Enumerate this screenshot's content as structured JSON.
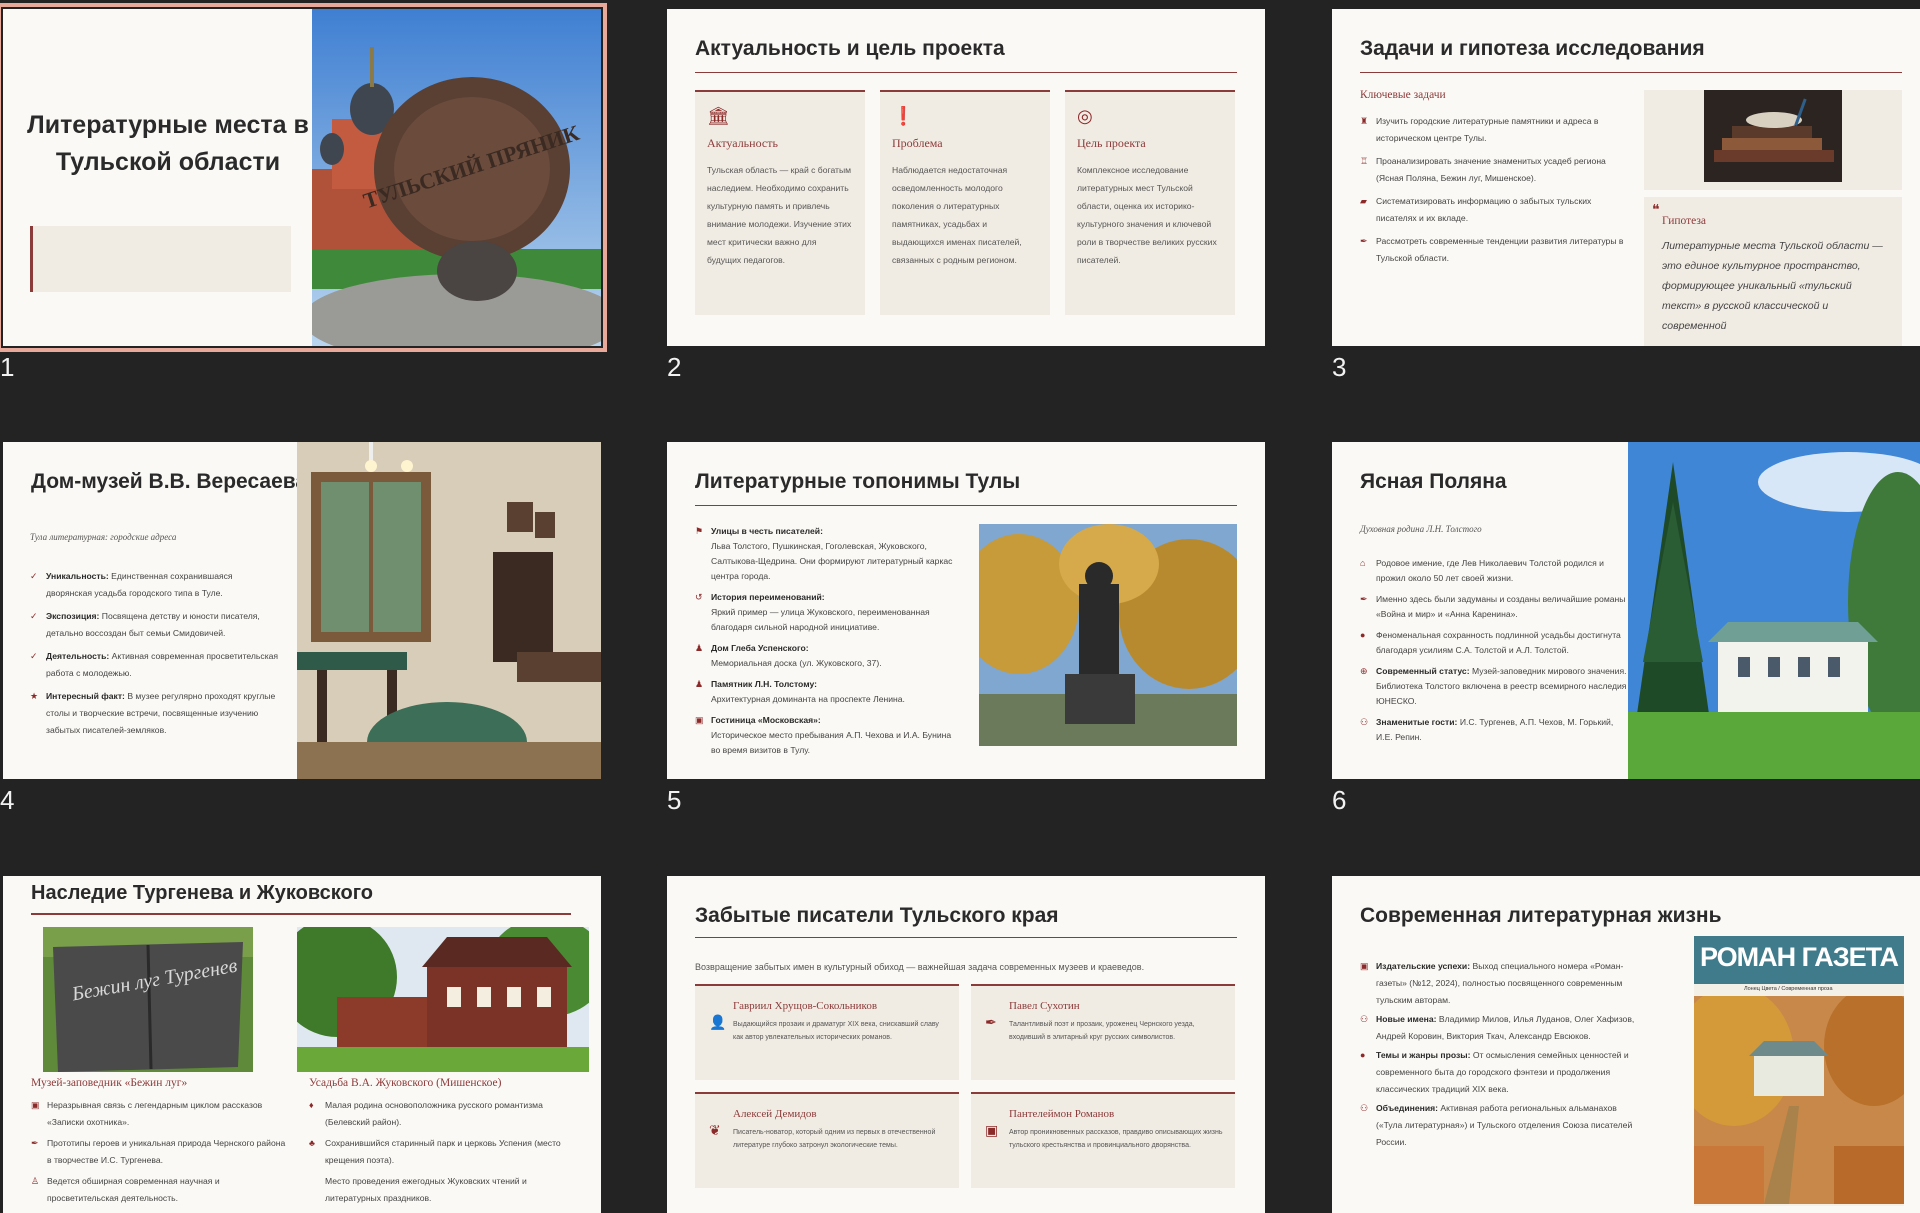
{
  "slide_numbers": [
    "1",
    "2",
    "3",
    "4",
    "5",
    "6",
    "7",
    "8",
    "9"
  ],
  "s1": {
    "title": "Литературные места в Тульской области",
    "stone_text": "ТУЛЬСКИЙ ПРЯНИК"
  },
  "s2": {
    "title": "Актуальность и цель проекта",
    "cards": [
      {
        "icon": "🏛",
        "title": "Актуальность",
        "text": "Тульская область — край с богатым наследием. Необходимо сохранить культурную память и привлечь внимание молодежи. Изучение этих мест критически важно для будущих педагогов."
      },
      {
        "icon": "❗",
        "title": "Проблема",
        "text": "Наблюдается недостаточная осведомленность молодого поколения о литературных памятниках, усадьбах и выдающихся именах писателей, связанных с родным регионом."
      },
      {
        "icon": "◎",
        "title": "Цель проекта",
        "text": "Комплексное исследование литературных мест Тульской области, оценка их историко-культурного значения и ключевой роли в творчестве великих русских писателей."
      }
    ]
  },
  "s3": {
    "title": "Задачи и гипотеза исследования",
    "tasks_heading": "Ключевые задачи",
    "tasks": [
      "Изучить городские литературные памятники и адреса в историческом центре Тулы.",
      "Проанализировать значение знаменитых усадеб региона (Ясная Поляна, Бежин луг, Мишенское).",
      "Систематизировать информацию о забытых тульских писателях и их вкладе.",
      "Рассмотреть современные тенденции развития литературы в Тульской области."
    ],
    "quote_mark": "❝",
    "hyp_heading": "Гипотеза",
    "hyp_text": "Литературные места Тульской области — это единое культурное пространство, формирующее уникальный «тульский текст» в русской классической и современной"
  },
  "s4": {
    "title": "Дом-музей В.В. Вересаева",
    "subtitle": "Тула литературная: городские адреса",
    "items": [
      {
        "icon": "✓",
        "label": "Уникальность:",
        "text": "Единственная сохранившаяся дворянская усадьба городского типа в Туле."
      },
      {
        "icon": "✓",
        "label": "Экспозиция:",
        "text": "Посвящена детству и юности писателя, детально воссоздан быт семьи Смидовичей."
      },
      {
        "icon": "✓",
        "label": "Деятельность:",
        "text": "Активная современная просветительская работа с молодежью."
      },
      {
        "icon": "★",
        "label": "Интересный факт:",
        "text": "В музее регулярно проходят круглые столы и творческие встречи, посвященные изучению забытых писателей-земляков."
      }
    ]
  },
  "s5": {
    "title": "Литературные топонимы Тулы",
    "items": [
      {
        "icon": "⚑",
        "label": "Улицы в честь писателей:",
        "text": "Льва Толстого, Пушкинская, Гоголевская, Жуковского, Салтыкова-Щедрина. Они формируют литературный каркас центра города."
      },
      {
        "icon": "↺",
        "label": "История переименований:",
        "text": "Яркий пример — улица Жуковского, переименованная благодаря сильной народной инициативе."
      },
      {
        "icon": "♟",
        "label": "Дом Глеба Успенского:",
        "text": "Мемориальная доска (ул. Жуковского, 37)."
      },
      {
        "icon": "♟",
        "label": "Памятник Л.Н. Толстому:",
        "text": "Архитектурная доминанта на проспекте Ленина."
      },
      {
        "icon": "▣",
        "label": "Гостиница «Московская»:",
        "text": "Историческое место пребывания А.П. Чехова и И.А. Бунина во время визитов в Тулу."
      }
    ]
  },
  "s6": {
    "title": "Ясная Поляна",
    "subtitle": "Духовная родина Л.Н. Толстого",
    "items": [
      {
        "icon": "⌂",
        "label": "",
        "text": "Родовое имение, где Лев Николаевич Толстой родился и прожил около 50 лет своей жизни."
      },
      {
        "icon": "✒",
        "label": "",
        "text": "Именно здесь были задуманы и созданы величайшие романы «Война и мир» и «Анна Каренина»."
      },
      {
        "icon": "●",
        "label": "",
        "text": "Феноменальная сохранность подлинной усадьбы достигнута благодаря усилиям С.А. Толстой и А.Л. Толстой."
      },
      {
        "icon": "⊕",
        "label": "Современный статус:",
        "text": "Музей-заповедник мирового значения. Библиотека Толстого включена в реестр всемирного наследия ЮНЕСКО."
      },
      {
        "icon": "⚇",
        "label": "Знаменитые гости:",
        "text": "И.С. Тургенев, А.П. Чехов, М. Горький, И.Е. Репин."
      }
    ]
  },
  "s7": {
    "title": "Наследие Тургенева и Жуковского",
    "book_text": "Бежин луг Тургенев",
    "left_caption": "Музей-заповедник «Бежин луг»",
    "right_caption": "Усадьба В.А. Жуковского (Мишенское)",
    "left_items": [
      {
        "icon": "▣",
        "text": "Неразрывная связь с легендарным циклом рассказов «Записки охотника»."
      },
      {
        "icon": "✒",
        "text": "Прототипы героев и уникальная природа Чернского района в творчестве И.С. Тургенева."
      },
      {
        "icon": "♙",
        "text": "Ведется обширная современная научная и просветительская деятельность."
      }
    ],
    "right_items": [
      {
        "icon": "♦",
        "text": "Малая родина основоположника русского романтизма (Белевский район)."
      },
      {
        "icon": "♣",
        "text": "Сохранившийся старинный парк и церковь Успения (место крещения поэта)."
      },
      {
        "icon": "",
        "text": "Место проведения ежегодных Жуковских чтений и литературных праздников."
      }
    ]
  },
  "s8": {
    "title": "Забытые писатели Тульского края",
    "intro": "Возвращение забытых имен в культурный обиход — важнейшая задача современных музеев и краеведов.",
    "writers": [
      {
        "icon": "👤",
        "name": "Гавриил Хрущов-Сокольников",
        "text": "Выдающийся прозаик и драматург XIX века, снискавший славу как автор увлекательных исторических романов."
      },
      {
        "icon": "✒",
        "name": "Павел Сухотин",
        "text": "Талантливый поэт и прозаик, уроженец Чернского уезда, входивший в элитарный круг русских символистов."
      },
      {
        "icon": "❦",
        "name": "Алексей Демидов",
        "text": "Писатель-новатор, который одним из первых в отечественной литературе глубоко затронул экологические темы."
      },
      {
        "icon": "▣",
        "name": "Пантелеймон Романов",
        "text": "Автор проникновенных рассказов, правдиво описывающих жизнь тульского крестьянства и провинциального дворянства."
      }
    ]
  },
  "s9": {
    "title": "Современная литературная жизнь",
    "items": [
      {
        "icon": "▣",
        "label": "Издательские успехи:",
        "text": "Выход специального номера «Роман-газеты» (№12, 2024), полностью посвященного современным тульским авторам."
      },
      {
        "icon": "⚇",
        "label": "Новые имена:",
        "text": "Владимир Милов, Илья Луданов, Олег Хафизов, Андрей Коровин, Виктория Ткач, Александр Евсюков."
      },
      {
        "icon": "●",
        "label": "Темы и жанры прозы:",
        "text": "От осмысления семейных ценностей и современного быта до городского фэнтези и продолжения классических традиций XIX века."
      },
      {
        "icon": "⚇",
        "label": "Объединения:",
        "text": "Активная работа региональных альманахов («Тула литературная») и Тульского отделения Союза писателей России."
      }
    ],
    "magazine_title": "РОМАН ГАЗЕТА",
    "magazine_sub": "Лонец Цвета / Современная проза"
  }
}
